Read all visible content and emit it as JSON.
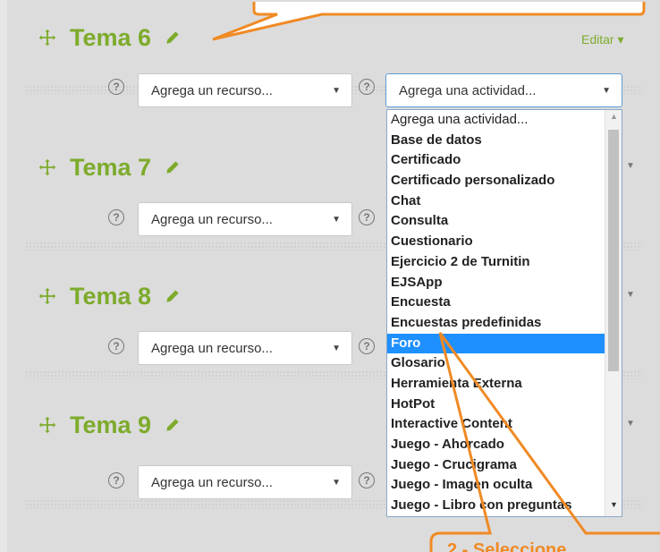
{
  "topics": [
    {
      "title": "Tema 6"
    },
    {
      "title": "Tema 7"
    },
    {
      "title": "Tema 8"
    },
    {
      "title": "Tema 9"
    }
  ],
  "editar_label": "Editar",
  "help_glyph": "?",
  "resource_select": {
    "value": "Agrega un recurso..."
  },
  "activity_select": {
    "value": "Agrega una actividad..."
  },
  "activity_options": [
    "Agrega una actividad...",
    "Base de datos",
    "Certificado",
    "Certificado personalizado",
    "Chat",
    "Consulta",
    "Cuestionario",
    "Ejercicio 2 de Turnitin",
    "EJSApp",
    "Encuesta",
    "Encuestas predefinidas",
    "Foro",
    "Glosario",
    "Herramienta Externa",
    "HotPot",
    "Interactive Content",
    "Juego - Ahorcado",
    "Juego - Crucigrama",
    "Juego - Imagen oculta",
    "Juego - Libro con preguntas"
  ],
  "selected_option": "Foro",
  "callout_text": "2.- Seleccione",
  "colors": {
    "accent_green": "#7dab2b",
    "callout_orange": "#f08a24",
    "selection_blue": "#1e90ff"
  }
}
